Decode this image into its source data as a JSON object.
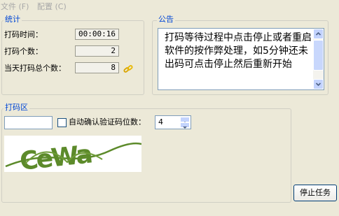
{
  "menu": {
    "file": "文件 (F)",
    "settings": "配置 (C)"
  },
  "stats": {
    "title": "统计",
    "coding_time_label": "打码时间：",
    "coding_time_value": "00:00:16",
    "coding_count_label": "打码个数：",
    "coding_count_value": "2",
    "today_total_label": "当天打码总个数：",
    "today_total_value": "8"
  },
  "notice": {
    "title": "公告",
    "text": "打码等待过程中点击停止或者重启软件的按作弊处理，如5分钟还未出码可点击停止然后重新开始"
  },
  "coding_area": {
    "title": "打码区",
    "answer_value": "",
    "auto_confirm_label": "自动确认验证码位数：",
    "auto_confirm_checked": false,
    "digit_count_value": "4",
    "captcha_text": "CeWa"
  },
  "buttons": {
    "stop_task": "停止任务"
  },
  "icons": {
    "chain": "chain-link-icon"
  },
  "colors": {
    "group_title": "#0046d5",
    "window_bg": "#ece9d8",
    "captcha_green": "#5c8a2a"
  }
}
